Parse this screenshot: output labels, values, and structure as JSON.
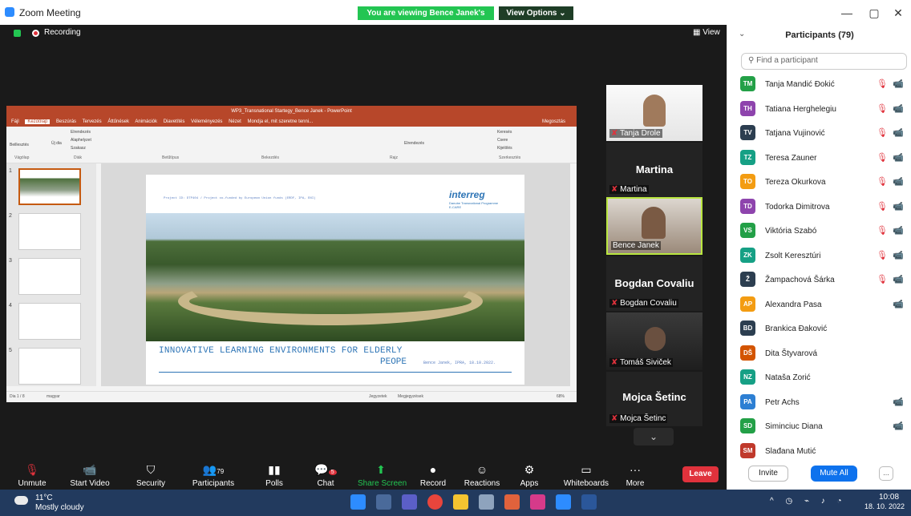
{
  "window": {
    "title": "Zoom Meeting",
    "banner": "You are viewing Bence Janek's screen",
    "view_options": "View Options ⌄",
    "minimize": "—",
    "maximize": "▢",
    "close": "✕"
  },
  "stage": {
    "recording": "Recording",
    "view": "View"
  },
  "ppt": {
    "titlebar": "WP3_Transnational Startegy_Bence Janek - PowerPoint",
    "tabs": [
      "Fájl",
      "Kezdőlap",
      "Beszúrás",
      "Tervezés",
      "Áttűnések",
      "Animációk",
      "Diavetítés",
      "Véleményezés",
      "Nézet",
      "Mondja el, mit szeretne tenni..."
    ],
    "share": "Megosztás",
    "groups": [
      "Vágólap",
      "Diák",
      "Betűtípus",
      "Bekezdés",
      "Rajz",
      "Szerkesztés"
    ],
    "ribbon_items": {
      "paste": "Beillesztés",
      "new_slide": "Új dia",
      "layout": "Elrendezés",
      "reset": "Alaphelyzet",
      "section": "Szakasz",
      "arrange": "Elrendezés",
      "find": "Keresés",
      "replace": "Csere",
      "select": "Kijelölés"
    },
    "thumb_numbers": [
      "1",
      "2",
      "3",
      "4",
      "5"
    ],
    "status_left": "Dia 1 / 8",
    "status_lang": "magyar",
    "status_notes": "Jegyzetek",
    "status_comments": "Megjegyzések",
    "status_zoom": "68%"
  },
  "slide": {
    "header": "Project ID: DTP404 / Project co-funded by European Union funds (ERDF, IPA, ENI)",
    "logo": "interreg",
    "logo_sub": "Danube Transnational Programme",
    "logo_sub2": "E-CARE",
    "title_line1": "INNOVATIVE LEARNING ENVIRONMENTS FOR ELDERLY",
    "title_line2": "PEOPE",
    "author": "Bence Janek, IPRA, 18.10.2022."
  },
  "tiles": [
    {
      "name": "Tanja Drole"
    },
    {
      "bigname": "Martina",
      "name": "Martina"
    },
    {
      "name": "Bence Janek"
    },
    {
      "bigname": "Bogdan Covaliu",
      "name": "Bogdan Covaliu"
    },
    {
      "name": "Tomáš Siviček"
    },
    {
      "bigname": "Mojca Šetinc",
      "name": "Mojca Šetinc"
    }
  ],
  "panel": {
    "title": "Participants (79)",
    "search_placeholder": "Find a participant",
    "participants": [
      {
        "initials": "TM",
        "name": "Tanja Mandić Đokić",
        "color": "#23a047",
        "mic": true,
        "cam": true
      },
      {
        "initials": "TH",
        "name": "Tatiana Herghelegiu",
        "color": "#8e44ad",
        "mic": true,
        "cam": true
      },
      {
        "initials": "TV",
        "name": "Tatjana Vujinović",
        "color": "#2c3e50",
        "mic": true,
        "cam": true
      },
      {
        "initials": "TZ",
        "name": "Teresa Zauner",
        "color": "#16a085",
        "mic": true,
        "cam": true
      },
      {
        "initials": "TO",
        "name": "Tereza Okurkova",
        "color": "#f39c12",
        "mic": true,
        "cam": true
      },
      {
        "initials": "TD",
        "name": "Todorka Dimitrova",
        "color": "#8e44ad",
        "mic": true,
        "cam": true
      },
      {
        "initials": "VS",
        "name": "Viktória Szabó",
        "color": "#23a047",
        "mic": true,
        "cam": true
      },
      {
        "initials": "ZK",
        "name": "Zsolt Keresztúri",
        "color": "#16a085",
        "mic": true,
        "cam": true
      },
      {
        "initials": "Ž",
        "name": "Žampachová Šárka",
        "color": "#2c3e50",
        "mic": true,
        "cam": true
      },
      {
        "initials": "AP",
        "name": "Alexandra Pasa",
        "color": "#f39c12",
        "mic": false,
        "cam": true
      },
      {
        "initials": "BD",
        "name": "Brankica Đaković",
        "color": "#2c3e50",
        "mic": false,
        "cam": false
      },
      {
        "initials": "DŠ",
        "name": "Dita Štyvarová",
        "color": "#d35400",
        "mic": false,
        "cam": false
      },
      {
        "initials": "NZ",
        "name": "Nataša Zorić",
        "color": "#16a085",
        "mic": false,
        "cam": false
      },
      {
        "initials": "PA",
        "name": "Petr Achs",
        "color": "#2d7fd3",
        "mic": false,
        "cam": true
      },
      {
        "initials": "SD",
        "name": "Siminciuc Diana",
        "color": "#23a047",
        "mic": false,
        "cam": true
      },
      {
        "initials": "SM",
        "name": "Slađana Mutić",
        "color": "#c0392b",
        "mic": false,
        "cam": false
      }
    ],
    "invite": "Invite",
    "mute_all": "Mute All",
    "more": "..."
  },
  "toolbar": {
    "unmute": "Unmute",
    "start_video": "Start Video",
    "security": "Security",
    "participants": "Participants",
    "participants_count": "79",
    "polls": "Polls",
    "chat": "Chat",
    "chat_badge": "5",
    "share_screen": "Share Screen",
    "record": "Record",
    "reactions": "Reactions",
    "apps": "Apps",
    "whiteboards": "Whiteboards",
    "more": "More",
    "leave": "Leave"
  },
  "taskbar": {
    "temp": "11°C",
    "weather": "Mostly cloudy",
    "time": "10:08",
    "date": "18. 10. 2022"
  }
}
